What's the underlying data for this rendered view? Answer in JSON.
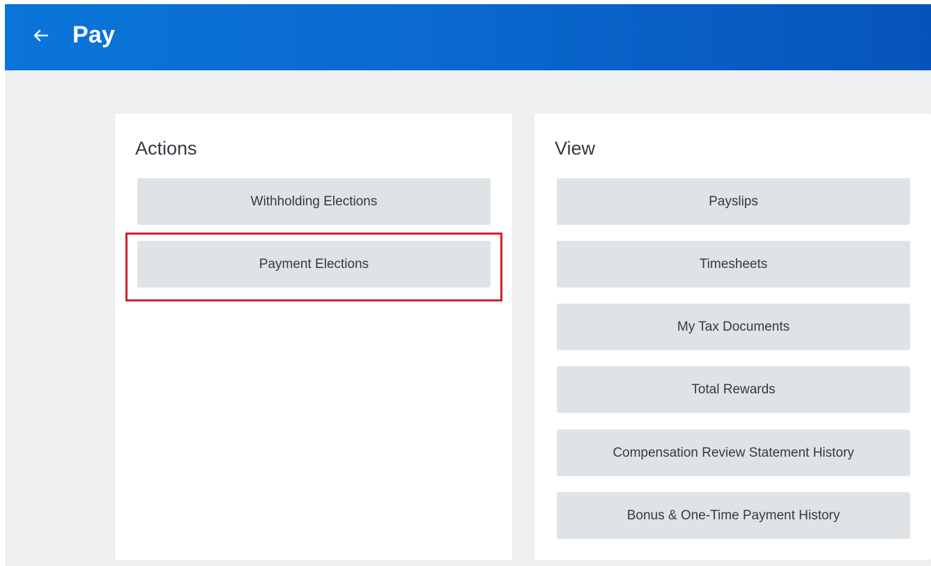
{
  "header": {
    "title": "Pay",
    "back_icon": "arrow-left-icon",
    "background_color": "#0a6ad0"
  },
  "actions": {
    "title": "Actions",
    "items": [
      {
        "label": "Withholding Elections"
      },
      {
        "label": "Payment Elections",
        "highlighted": true
      }
    ],
    "highlight_color": "#d4202b"
  },
  "view": {
    "title": "View",
    "items": [
      {
        "label": "Payslips"
      },
      {
        "label": "Timesheets"
      },
      {
        "label": "My Tax Documents"
      },
      {
        "label": "Total Rewards"
      },
      {
        "label": "Compensation Review Statement History"
      },
      {
        "label": "Bonus & One-Time Payment History"
      }
    ]
  }
}
